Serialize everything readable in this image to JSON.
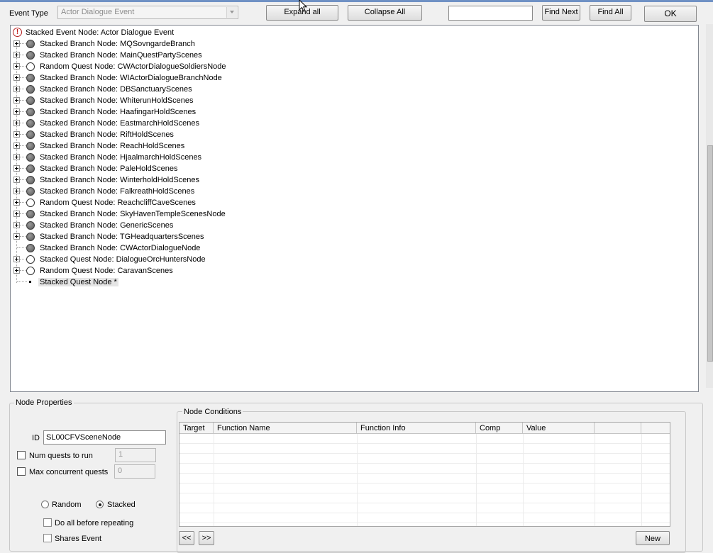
{
  "toolbar": {
    "event_type_label": "Event Type",
    "event_type_value": "Actor Dialogue Event",
    "expand_all": "Expand all",
    "collapse_all": "Collapse All",
    "find_value": "",
    "find_next": "Find Next",
    "find_all": "Find All",
    "ok": "OK"
  },
  "tree": {
    "root": "Stacked Event Node: Actor Dialogue Event",
    "nodes": [
      {
        "label": "Stacked Branch Node: MQSovngardeBranch",
        "icon": "filled-circle-icon",
        "expandable": true
      },
      {
        "label": "Stacked Branch Node: MainQuestPartyScenes",
        "icon": "filled-circle-icon",
        "expandable": true
      },
      {
        "label": "Random Quest Node: CWActorDialogueSoldiersNode",
        "icon": "open-circle-icon",
        "expandable": true
      },
      {
        "label": "Stacked Branch Node: WIActorDialogueBranchNode",
        "icon": "filled-circle-icon",
        "expandable": true
      },
      {
        "label": "Stacked Branch Node: DBSanctuaryScenes",
        "icon": "filled-circle-icon",
        "expandable": true
      },
      {
        "label": "Stacked Branch Node: WhiterunHoldScenes",
        "icon": "filled-circle-icon",
        "expandable": true
      },
      {
        "label": "Stacked Branch Node: HaafingarHoldScenes",
        "icon": "filled-circle-icon",
        "expandable": true
      },
      {
        "label": "Stacked Branch Node: EastmarchHoldScenes",
        "icon": "filled-circle-icon",
        "expandable": true
      },
      {
        "label": "Stacked Branch Node: RiftHoldScenes",
        "icon": "filled-circle-icon",
        "expandable": true
      },
      {
        "label": "Stacked Branch Node: ReachHoldScenes",
        "icon": "filled-circle-icon",
        "expandable": true
      },
      {
        "label": "Stacked Branch Node: HjaalmarchHoldScenes",
        "icon": "filled-circle-icon",
        "expandable": true
      },
      {
        "label": "Stacked Branch Node: PaleHoldScenes",
        "icon": "filled-circle-icon",
        "expandable": true
      },
      {
        "label": "Stacked Branch Node: WinterholdHoldScenes",
        "icon": "filled-circle-icon",
        "expandable": true
      },
      {
        "label": "Stacked Branch Node: FalkreathHoldScenes",
        "icon": "filled-circle-icon",
        "expandable": true
      },
      {
        "label": "Random Quest Node: ReachcliffCaveScenes",
        "icon": "open-circle-icon",
        "expandable": true
      },
      {
        "label": "Stacked Branch Node: SkyHavenTempleScenesNode",
        "icon": "filled-circle-icon",
        "expandable": true
      },
      {
        "label": "Stacked Branch Node: GenericScenes",
        "icon": "filled-circle-icon",
        "expandable": true
      },
      {
        "label": "Stacked Branch Node: TGHeadquartersScenes",
        "icon": "filled-circle-icon",
        "expandable": true
      },
      {
        "label": "Stacked Branch Node: CWActorDialogueNode",
        "icon": "filled-circle-icon",
        "expandable": false
      },
      {
        "label": "Stacked Quest Node: DialogueOrcHuntersNode",
        "icon": "open-circle-icon",
        "expandable": true
      },
      {
        "label": "Random Quest Node: CaravanScenes",
        "icon": "open-circle-icon",
        "expandable": true
      }
    ],
    "selected": "Stacked Quest Node *"
  },
  "node_properties": {
    "title": "Node Properties",
    "id_label": "ID",
    "id_value": "SL00CFVSceneNode",
    "num_quests_label": "Num quests to run",
    "num_quests_value": "1",
    "max_concurrent_label": "Max concurrent quests",
    "max_concurrent_value": "0",
    "random_label": "Random",
    "stacked_label": "Stacked",
    "do_all_label": "Do all before repeating",
    "shares_event_label": "Shares Event"
  },
  "conditions": {
    "title": "Node Conditions",
    "columns": [
      "Target",
      "Function Name",
      "Function Info",
      "Comp",
      "Value",
      ""
    ],
    "prev": "<<",
    "next": ">>",
    "new": "New"
  },
  "colors": {
    "window_bg": "#f0f0f0",
    "title_accent": "#6f91c4",
    "error_red": "#c01818"
  }
}
